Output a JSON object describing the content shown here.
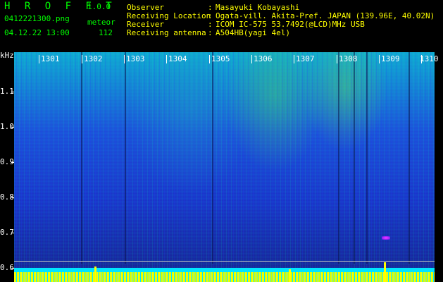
{
  "header": {
    "app_title": "H R O F F T",
    "version": "1.0.0",
    "filename": "0412221300.png",
    "meteor_label": "meteor",
    "datetime": "04.12.22 13:00",
    "meteor_count": "112",
    "info": [
      {
        "key": "Observer",
        "value": "Masayuki Kobayashi"
      },
      {
        "key": "Receiving Location",
        "value": "Ogata-vill. Akita-Pref. JAPAN (139.96E, 40.02N)"
      },
      {
        "key": "Receiver",
        "value": "ICOM IC-575 53.7492(@LCD)MHz USB"
      },
      {
        "key": "Receiving antenna",
        "value": "A504HB(yagi 4el)"
      }
    ]
  },
  "spectrogram": {
    "y_unit": "kHz",
    "y_ticks": [
      "1.1",
      "1.0",
      "0.9",
      "0.8",
      "0.7",
      "0.6"
    ],
    "x_ticks": [
      "1301",
      "1302",
      "1303",
      "1304",
      "1305",
      "1306",
      "1307",
      "1308",
      "1309",
      "1310"
    ]
  }
}
